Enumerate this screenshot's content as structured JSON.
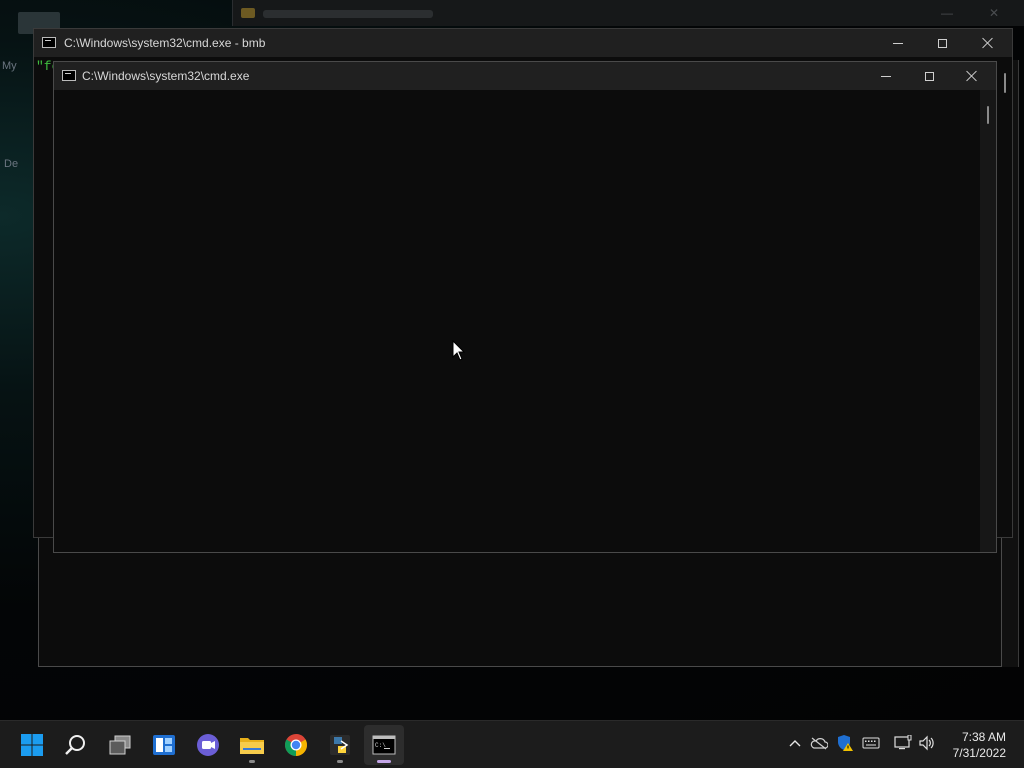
{
  "desktop": {
    "icon_labels": [
      "My",
      "De"
    ]
  },
  "back_console": {
    "title": "C:\\Windows\\system32\\cmd.exe - bmb",
    "visible_text": "\"fc"
  },
  "front_console": {
    "title": "C:\\Windows\\system32\\cmd.exe"
  },
  "taskbar": {
    "items": [
      {
        "name": "start-button",
        "icon": "windows-logo-icon"
      },
      {
        "name": "search-button",
        "icon": "search-icon"
      },
      {
        "name": "task-view-button",
        "icon": "task-view-icon"
      },
      {
        "name": "widgets-button",
        "icon": "widgets-icon"
      },
      {
        "name": "chat-button",
        "icon": "teams-chat-icon"
      },
      {
        "name": "file-explorer-button",
        "icon": "folder-icon"
      },
      {
        "name": "chrome-button",
        "icon": "chrome-icon"
      },
      {
        "name": "python-app-button",
        "icon": "python-icon"
      },
      {
        "name": "cmd-button",
        "icon": "terminal-icon"
      }
    ],
    "tray": [
      "chevron-up-icon",
      "onedrive-icon",
      "defender-warning-icon",
      "keyboard-icon",
      "network-icon",
      "speaker-icon"
    ],
    "time": "7:38 AM",
    "date": "7/31/2022"
  },
  "colors": {
    "accent_active_indicator": "#c4a6e8",
    "windows_blue": "#1b9cf0",
    "console_bg": "#0c0c0c",
    "titlebar_bg": "#202020"
  }
}
